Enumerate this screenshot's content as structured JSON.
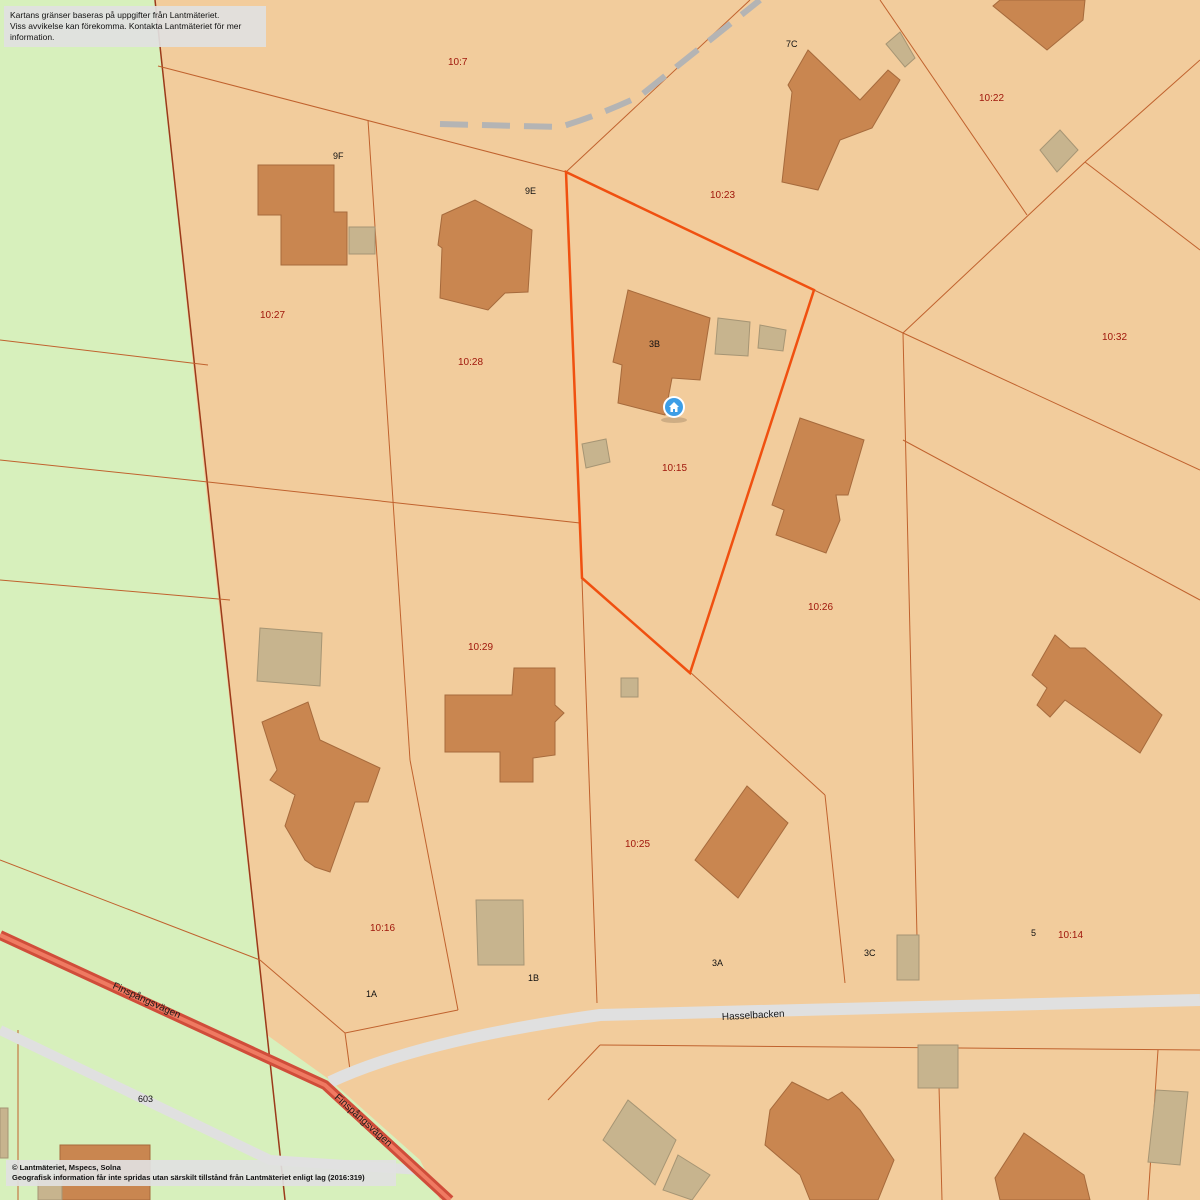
{
  "disclaimer": {
    "line1": "Kartans gränser baseras på uppgifter från Lantmäteriet.",
    "line2": "Viss avvikelse kan förekomma. Kontakta Lantmäteriet för mer information."
  },
  "credits": {
    "line1": "© Lantmäteriet, Mspecs, Solna",
    "line2": "Geografisk information får inte spridas utan särskilt tillstånd från Lantmäteriet enligt lag (2016:319)"
  },
  "parcels": {
    "p10_7": "10:7",
    "p10_22": "10:22",
    "p10_23": "10:23",
    "p10_27": "10:27",
    "p10_28": "10:28",
    "p10_15": "10:15",
    "p10_32": "10:32",
    "p10_26": "10:26",
    "p10_29": "10:29",
    "p10_25": "10:25",
    "p10_16": "10:16",
    "p10_14": "10:14"
  },
  "addresses": {
    "a7C": "7C",
    "a9F": "9F",
    "a9E": "9E",
    "a3B": "3B",
    "a3A": "3A",
    "a3C": "3C",
    "a5": "5",
    "a1A": "1A",
    "a1B": "1B",
    "a603": "603"
  },
  "roads": {
    "finspang1": "Finspångsvägen",
    "finspang2": "Finspångsvägen",
    "hasselbacken": "Hasselbacken"
  },
  "colors": {
    "parcel_fill": "#f2cc9c",
    "green_area": "#d7f0bc",
    "building": "#c98650",
    "outbuilding": "#c7b48e",
    "boundary": "#c0622e",
    "selected_boundary": "#f05010",
    "road": "#e0e0e0",
    "main_road": "#e05a45"
  },
  "icons": {
    "marker": "home-marker-icon"
  }
}
